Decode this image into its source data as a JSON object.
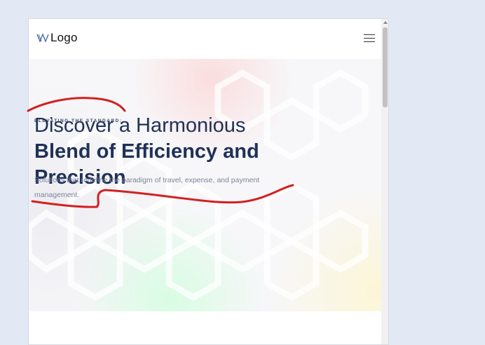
{
  "header": {
    "logo_text": "Logo",
    "logo_icon": "w-logo-icon",
    "menu_icon": "hamburger-menu-icon"
  },
  "hero": {
    "eyebrow": "ELEVATING THE STANDARD:",
    "title_line1": "Discover a Harmonious",
    "title_line2": "Blend of Efficiency and",
    "title_line3": "Precision",
    "subtitle": "Solutions that redefine the paradigm of travel, expense, and payment management."
  },
  "colors": {
    "page_background": "#e2e8f4",
    "title": "#1f3157",
    "subtitle": "#7c859b",
    "annotation": "#d42020"
  }
}
